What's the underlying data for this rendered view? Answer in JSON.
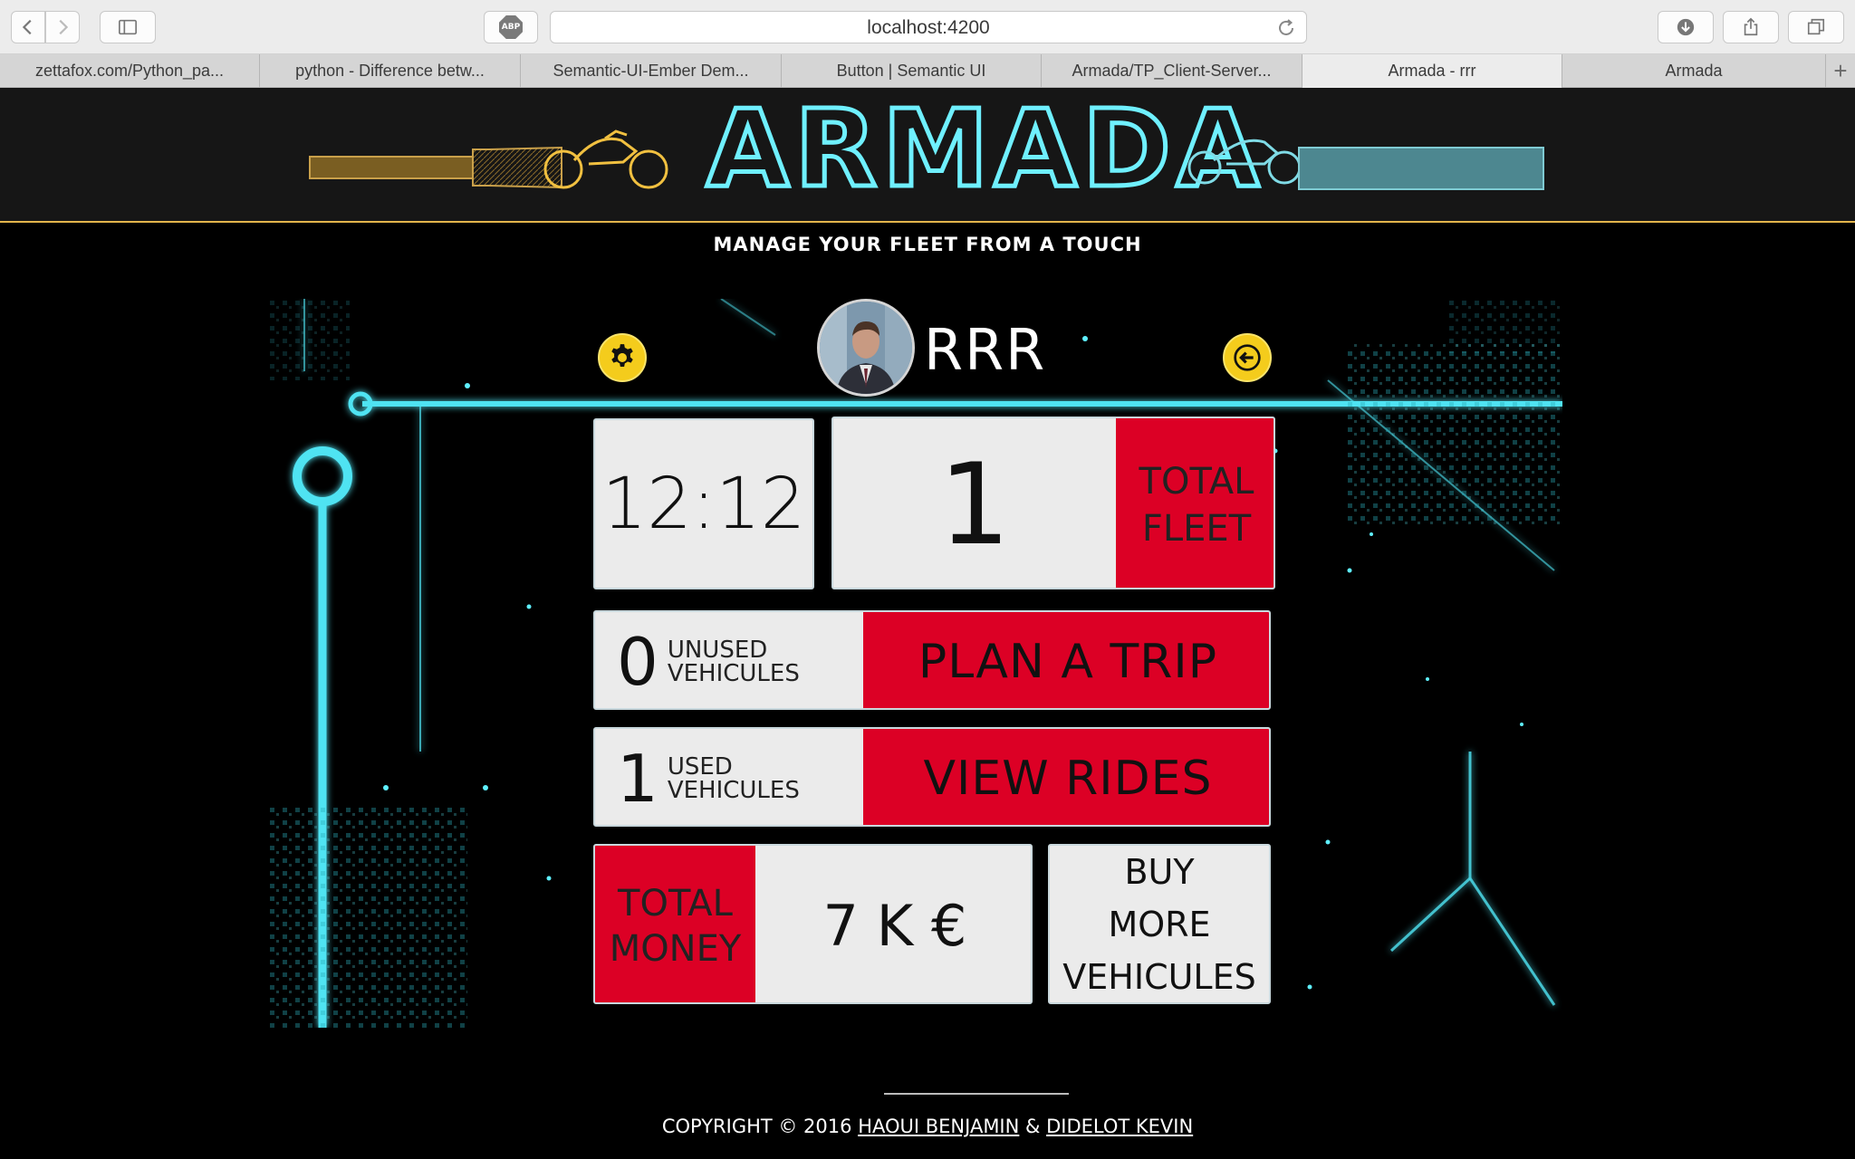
{
  "browser": {
    "url": "localhost:4200",
    "adblock_label": "ABP",
    "new_tab_label": "+",
    "tabs": [
      {
        "label": "zettafox.com/Python_pa..."
      },
      {
        "label": "python - Difference betw..."
      },
      {
        "label": "Semantic-UI-Ember Dem..."
      },
      {
        "label": "Button | Semantic UI"
      },
      {
        "label": "Armada/TP_Client-Server..."
      },
      {
        "label": "Armada - rrr"
      },
      {
        "label": "Armada"
      }
    ]
  },
  "header": {
    "logo_text": "ARMADA",
    "tagline": "MANAGE YOUR FLEET FROM A TOUCH"
  },
  "profile": {
    "username": "RRR"
  },
  "dashboard": {
    "clock": "12:12",
    "fleet_count": "1",
    "fleet_label_1": "TOTAL",
    "fleet_label_2": "FLEET",
    "unused_count": "0",
    "unused_label_1": "UNUSED",
    "unused_label_2": "VEHICULES",
    "plan_trip_label": "PLAN A TRIP",
    "used_count": "1",
    "used_label_1": "USED",
    "used_label_2": "VEHICULES",
    "view_rides_label": "VIEW RIDES",
    "money_label_1": "TOTAL",
    "money_label_2": "MONEY",
    "money_value": "7 K €",
    "buy_label_1": "BUY",
    "buy_label_2": "MORE",
    "buy_label_3": "VEHICULES"
  },
  "footer": {
    "prefix": "COPYRIGHT © 2016 ",
    "author1": "HAOUI BENJAMIN",
    "separator": " & ",
    "author2": "DIDELOT KEVIN"
  },
  "colors": {
    "accent_red": "#dc0025",
    "accent_yellow": "#f4cc1c",
    "neon_cyan": "#4fe3f2",
    "logo_gold": "#e3b54c"
  }
}
